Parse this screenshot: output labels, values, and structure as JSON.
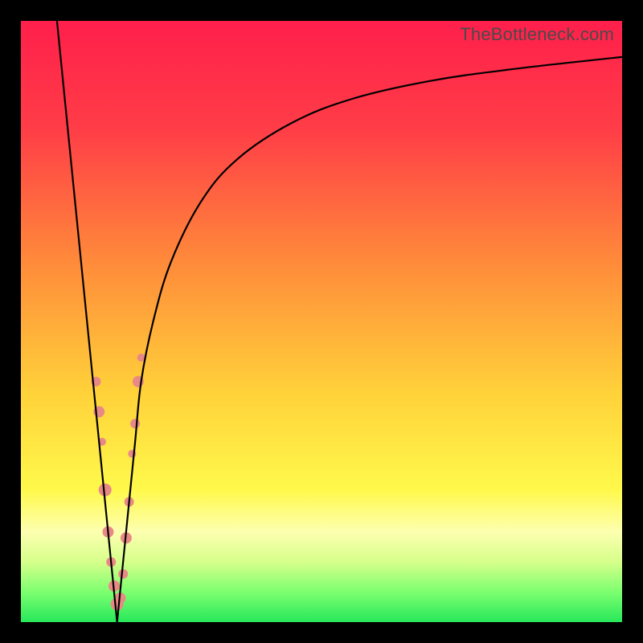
{
  "watermark": "TheBottleneck.com",
  "colors": {
    "frame": "#000000",
    "gradient_stops": [
      {
        "pct": 0,
        "color": "#ff1f4b"
      },
      {
        "pct": 18,
        "color": "#ff3d47"
      },
      {
        "pct": 40,
        "color": "#ff8a3a"
      },
      {
        "pct": 62,
        "color": "#ffd23a"
      },
      {
        "pct": 78,
        "color": "#fff94b"
      },
      {
        "pct": 85,
        "color": "#fdffb0"
      },
      {
        "pct": 90,
        "color": "#d6ff8a"
      },
      {
        "pct": 95,
        "color": "#7cff70"
      },
      {
        "pct": 100,
        "color": "#27e85a"
      }
    ],
    "curve": "#000000",
    "dot_fill": "#e98985",
    "dot_stroke": "#d06763"
  },
  "chart_data": {
    "type": "line",
    "title": "",
    "xlabel": "",
    "ylabel": "",
    "xlim": [
      0,
      100
    ],
    "ylim": [
      0,
      100
    ],
    "notch_x": 16,
    "series": [
      {
        "name": "left-branch",
        "x": [
          6,
          7,
          8,
          9,
          10,
          11,
          12,
          13,
          14,
          15,
          16
        ],
        "y": [
          100,
          90,
          80,
          70,
          60,
          50,
          40,
          30,
          20,
          10,
          0
        ]
      },
      {
        "name": "right-branch",
        "x": [
          16,
          17,
          18,
          19,
          20,
          22,
          25,
          30,
          36,
          45,
          55,
          68,
          82,
          100
        ],
        "y": [
          0,
          10,
          20,
          30,
          40,
          50,
          60,
          70,
          77,
          83,
          87,
          90,
          92,
          94
        ]
      }
    ],
    "dots": [
      {
        "x": 12.5,
        "y": 40,
        "r": 6
      },
      {
        "x": 13.0,
        "y": 35,
        "r": 7
      },
      {
        "x": 13.5,
        "y": 30,
        "r": 5
      },
      {
        "x": 14.0,
        "y": 22,
        "r": 8
      },
      {
        "x": 14.5,
        "y": 15,
        "r": 7
      },
      {
        "x": 15.0,
        "y": 10,
        "r": 6
      },
      {
        "x": 15.5,
        "y": 6,
        "r": 7
      },
      {
        "x": 16.0,
        "y": 3,
        "r": 8
      },
      {
        "x": 16.5,
        "y": 4,
        "r": 7
      },
      {
        "x": 17.0,
        "y": 8,
        "r": 6
      },
      {
        "x": 17.5,
        "y": 14,
        "r": 7
      },
      {
        "x": 18.0,
        "y": 20,
        "r": 6
      },
      {
        "x": 18.5,
        "y": 28,
        "r": 5
      },
      {
        "x": 19.0,
        "y": 33,
        "r": 6
      },
      {
        "x": 19.5,
        "y": 40,
        "r": 7
      },
      {
        "x": 20.0,
        "y": 44,
        "r": 5
      }
    ]
  }
}
